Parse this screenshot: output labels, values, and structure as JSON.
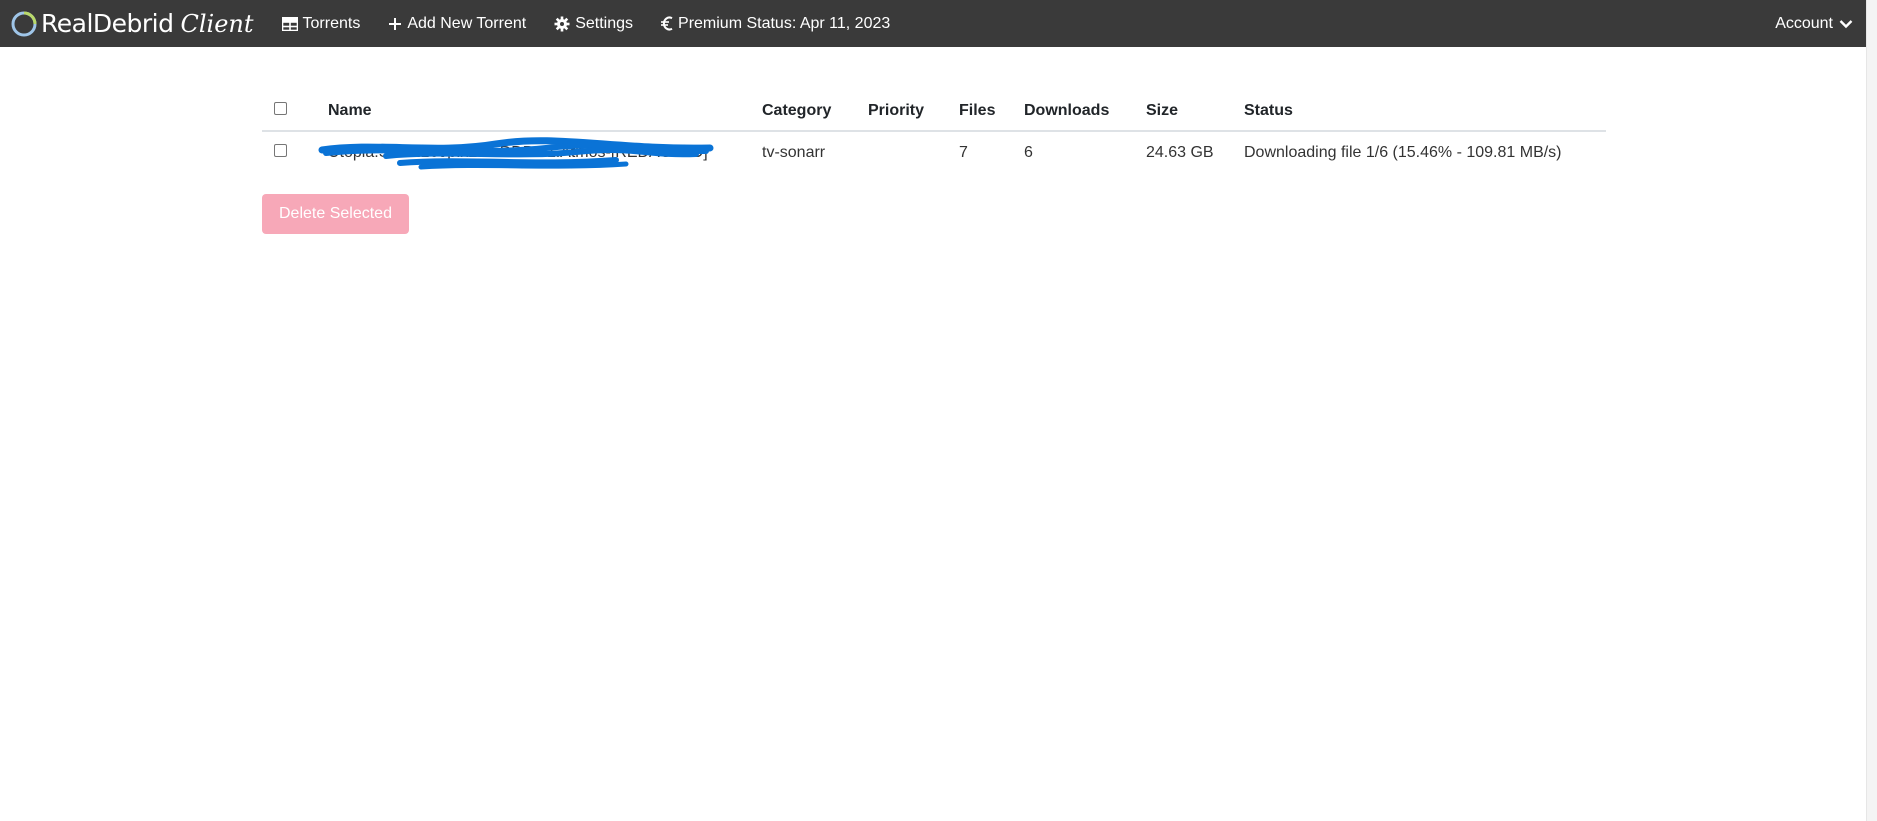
{
  "navbar": {
    "brand_name": "RealDebrid",
    "brand_suffix": "Client",
    "items": [
      {
        "label": "Torrents",
        "icon": "grid-table-icon"
      },
      {
        "label": "Add New Torrent",
        "icon": "plus-icon"
      },
      {
        "label": "Settings",
        "icon": "gear-icon"
      },
      {
        "label": "Premium Status: Apr 11, 2023",
        "icon": "euro-icon"
      }
    ],
    "account_label": "Account",
    "account_icon": "chevron-down-icon",
    "background_color": "#3a3a3a"
  },
  "table": {
    "columns": [
      "Name",
      "Category",
      "Priority",
      "Files",
      "Downloads",
      "Size",
      "Status"
    ],
    "rows": [
      {
        "name": "Utopia.S01.2160p.x264.DDP5.1.Atmos-[REDACTED]",
        "category": "tv-sonarr",
        "priority": "",
        "files": "7",
        "downloads": "6",
        "size": "24.63 GB",
        "status": "Downloading file 1/6 (15.46% - 109.81 MB/s)"
      }
    ]
  },
  "actions": {
    "delete_selected_label": "Delete Selected",
    "delete_button_color": "#f7a8b8"
  }
}
